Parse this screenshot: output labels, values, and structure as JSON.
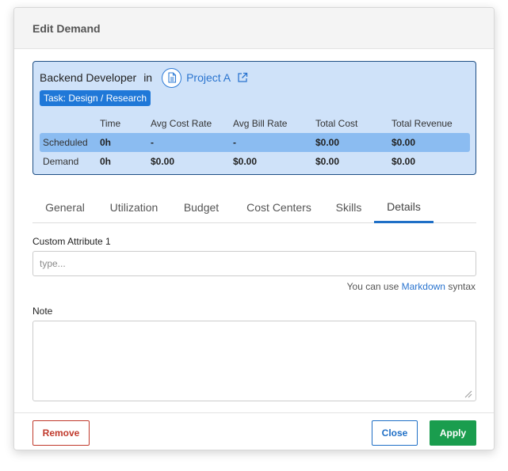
{
  "modal": {
    "title": "Edit Demand"
  },
  "summary": {
    "role": "Backend Developer",
    "in_word": "in",
    "project": "Project A",
    "project_icon": "document-icon",
    "external_icon": "external-link-icon",
    "task_badge": "Task: Design / Research",
    "headers": [
      "",
      "Time",
      "Avg Cost Rate",
      "Avg Bill Rate",
      "Total Cost",
      "Total Revenue"
    ],
    "rows": [
      {
        "label": "Scheduled",
        "time": "0h",
        "avg_cost_rate": "-",
        "avg_bill_rate": "-",
        "total_cost": "$0.00",
        "total_revenue": "$0.00"
      },
      {
        "label": "Demand",
        "time": "0h",
        "avg_cost_rate": "$0.00",
        "avg_bill_rate": "$0.00",
        "total_cost": "$0.00",
        "total_revenue": "$0.00"
      }
    ]
  },
  "tabs": [
    {
      "label": "General",
      "active": false
    },
    {
      "label": "Utilization",
      "active": false
    },
    {
      "label": "Budget",
      "active": false
    },
    {
      "label": "Cost Centers",
      "active": false
    },
    {
      "label": "Skills",
      "active": false
    },
    {
      "label": "Details",
      "active": true
    }
  ],
  "form": {
    "custom_attribute_label": "Custom Attribute 1",
    "custom_attribute_placeholder": "type...",
    "custom_attribute_value": "",
    "hint_prefix": "You can use",
    "hint_link": "Markdown",
    "hint_suffix": "syntax",
    "note_label": "Note",
    "note_value": ""
  },
  "footer": {
    "remove_label": "Remove",
    "close_label": "Close",
    "apply_label": "Apply"
  },
  "colors": {
    "summary_bg": "#cfe2f9",
    "scheduled_row": "#8bbcf1",
    "accent": "#1f6fc6",
    "danger": "#c0392b",
    "success": "#1a9d4e"
  }
}
